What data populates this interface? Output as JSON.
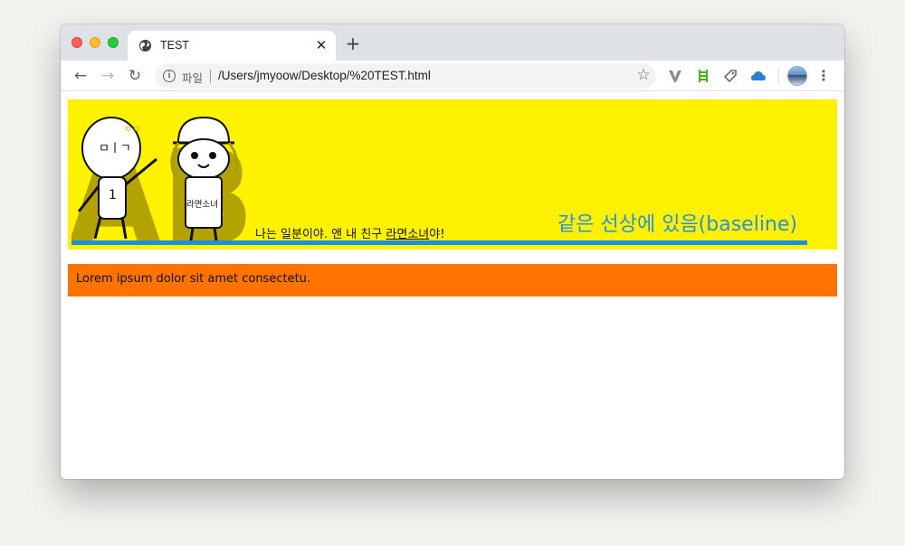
{
  "browser": {
    "tab": {
      "title": "TEST",
      "close_glyph": "✕",
      "icon": "globe-icon"
    },
    "new_tab_glyph": "+",
    "nav": {
      "back": "←",
      "forward": "→",
      "reload": "↻"
    },
    "omnibox": {
      "scheme_label": "파일",
      "url": "/Users/jmyoow/Desktop/%20TEST.html",
      "info_glyph": "i",
      "star_glyph": "☆"
    },
    "extensions": [
      "vimeo-v-icon",
      "ladder-icon",
      "tag-icon",
      "cloud-icon"
    ],
    "menu_glyph": "⋮"
  },
  "page": {
    "banner": {
      "logo_letters": "AB",
      "character_left_label": "ㅇㅇ",
      "character_left_face": "ㅁㅣㄱ",
      "character_left_badge": "1",
      "character_right_shirt": "라면소녀",
      "caption_prefix": "나는 일분이야. 앤 내 친구 ",
      "caption_link": "라면소녀",
      "caption_suffix": "야!",
      "baseline_label": "같은 선상에 있음(baseline)"
    },
    "bar": {
      "text": "Lorem ipsum dolor sit amet consectetu."
    }
  },
  "colors": {
    "banner_bg": "#fff200",
    "baseline_rule": "#1e8fe0",
    "baseline_text": "#2d8fdc",
    "bar_bg": "#ff7300"
  }
}
